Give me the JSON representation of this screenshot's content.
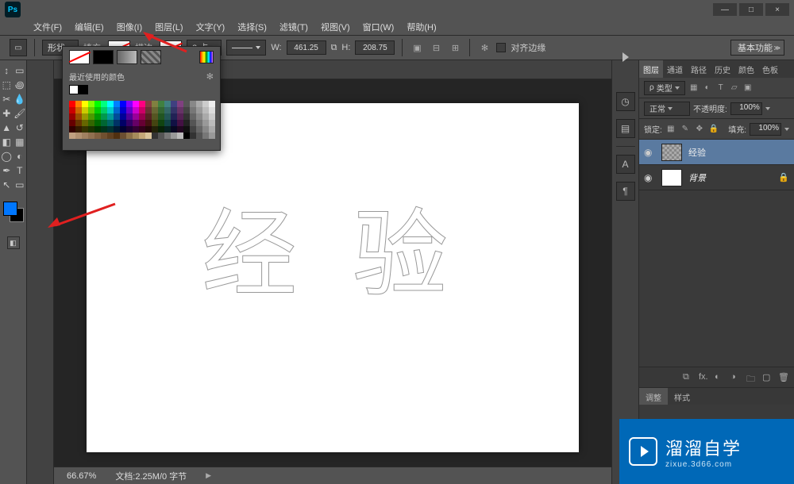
{
  "app": {
    "logo": "Ps"
  },
  "window": {
    "min": "—",
    "max": "□",
    "close": "×"
  },
  "menu": {
    "file": "文件(F)",
    "edit": "编辑(E)",
    "image": "图像(I)",
    "layer": "图层(L)",
    "type": "文字(Y)",
    "select": "选择(S)",
    "filter": "滤镜(T)",
    "view": "视图(V)",
    "window": "窗口(W)",
    "help": "帮助(H)"
  },
  "options": {
    "shape_mode": "形状",
    "fill_label": "填充:",
    "stroke_label": "描边:",
    "stroke_width": "3 点",
    "w_label": "W:",
    "w_value": "461.25",
    "h_label": "H:",
    "h_value": "208.75",
    "align_edges": "对齐边缘",
    "workspace": "基本功能"
  },
  "colorpicker": {
    "recent_label": "最近使用的颜色",
    "recent": [
      "#ffffff",
      "#000000"
    ]
  },
  "canvas": {
    "text": "经 验"
  },
  "status": {
    "zoom": "66.67%",
    "doc": "文档:2.25M/0 字节"
  },
  "panels_collapsed": {
    "history": "◷",
    "char": "A",
    "para": "¶"
  },
  "layers_panel": {
    "tabs": {
      "layers": "图层",
      "channels": "通道",
      "paths": "路径",
      "history": "历史",
      "color": "颜色",
      "swatches": "色板"
    },
    "kind_label": "类型",
    "blend_mode": "正常",
    "opacity_label": "不透明度:",
    "opacity_value": "100%",
    "lock_label": "锁定:",
    "fill_label": "填充:",
    "fill_value": "100%",
    "layers": [
      {
        "name": "经验",
        "visible": true,
        "type": "shape",
        "selected": true
      },
      {
        "name": "背景",
        "visible": true,
        "type": "bg",
        "locked": true,
        "italic": true
      }
    ]
  },
  "panel2": {
    "adjust": "调整",
    "styles": "样式"
  },
  "watermark": {
    "title": "溜溜自学",
    "sub": "zixue.3d66.com"
  },
  "icons": {
    "rect": "▭",
    "arrow": "↕",
    "gear": "✻",
    "eye": "◉",
    "lock": "🔒",
    "trash": "🗑",
    "folder": "🗀",
    "new": "▢",
    "fx": "fx.",
    "mask": "◐",
    "link": "⧉",
    "chevdn": "▾",
    "close": "×",
    "divide": "÷"
  }
}
